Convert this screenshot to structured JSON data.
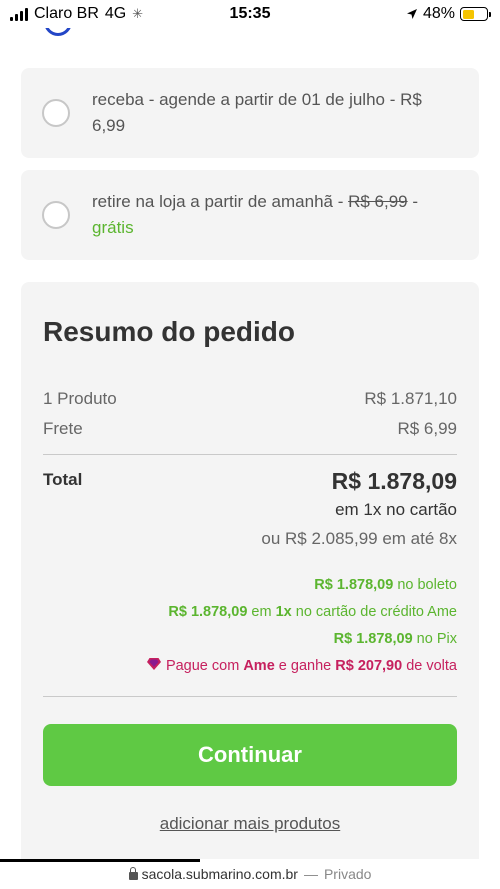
{
  "status_bar": {
    "carrier": "Claro BR",
    "network": "4G",
    "time": "15:35",
    "battery": "48%",
    "battery_level": 0.48
  },
  "delivery_options": [
    {
      "text_prefix": "receba - agende a partir de 01 de julho - R$ 6,99",
      "old_price": "",
      "suffix": ""
    },
    {
      "text_prefix": "retire na loja a partir de amanhã - ",
      "old_price": "R$ 6,99",
      "separator": " - ",
      "suffix": "grátis"
    }
  ],
  "summary": {
    "title": "Resumo do pedido",
    "product_label": "1 Produto",
    "product_value": "R$ 1.871,10",
    "shipping_label": "Frete",
    "shipping_value": "R$ 6,99",
    "total_label": "Total",
    "total_value": "R$ 1.878,09",
    "cash_text": "em 1x no cartão",
    "installments_text": "ou R$ 2.085,99 em até 8x",
    "boleto_value": "R$ 1.878,09",
    "boleto_text": " no boleto",
    "card_value": "R$ 1.878,09",
    "card_text_1": " em ",
    "card_times": "1x",
    "card_text_2": " no cartão de crédito Ame",
    "pix_value": "R$ 1.878,09",
    "pix_text": " no Pix",
    "ame_text_1": "Pague com ",
    "ame_brand": "Ame",
    "ame_text_2": " e ganhe ",
    "ame_cashback": "R$ 207,90",
    "ame_text_3": " de volta",
    "continue_label": "Continuar",
    "more_label": "adicionar mais produtos"
  },
  "browser": {
    "url": "sacola.submarino.com.br",
    "separator": "—",
    "mode": "Privado"
  },
  "colors": {
    "accent_green": "#5fc944",
    "promo_green": "#5bb52f",
    "ame_pink": "#c6205e",
    "radio_selected": "#2346c7"
  }
}
